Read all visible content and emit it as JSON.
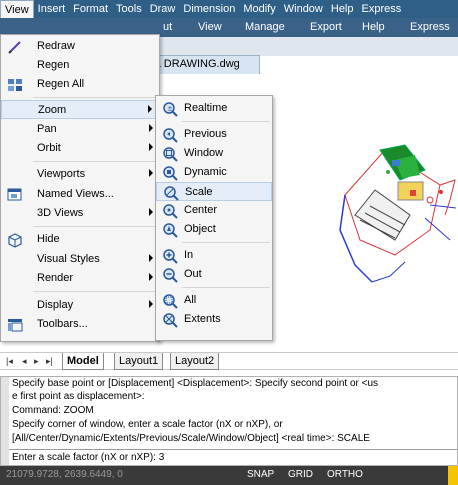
{
  "menubar": {
    "items": [
      "View",
      "Insert",
      "Format",
      "Tools",
      "Draw",
      "Dimension",
      "Modify",
      "Window",
      "Help",
      "Express"
    ]
  },
  "ribbon": {
    "tabs": [
      "ut",
      "View",
      "Manage",
      "Export",
      "Help",
      "Express"
    ]
  },
  "file_tab": {
    "label": "L DRAWING.dwg"
  },
  "view_menu": {
    "items": [
      {
        "label": "Redraw",
        "icon": "pencil-icon"
      },
      {
        "label": "Regen",
        "icon": ""
      },
      {
        "label": "Regen All",
        "icon": "regen-all-icon"
      },
      {
        "label": "Zoom",
        "icon": "",
        "submenu": true
      },
      {
        "label": "Pan",
        "icon": "",
        "submenu": true
      },
      {
        "label": "Orbit",
        "icon": "",
        "submenu": true
      },
      {
        "label": "Viewports",
        "icon": "",
        "submenu": true
      },
      {
        "label": "Named Views...",
        "icon": "named-views-icon"
      },
      {
        "label": "3D Views",
        "icon": "",
        "submenu": true
      },
      {
        "label": "Hide",
        "icon": "hide-cube-icon"
      },
      {
        "label": "Visual Styles",
        "icon": "",
        "submenu": true
      },
      {
        "label": "Render",
        "icon": "",
        "submenu": true
      },
      {
        "label": "Display",
        "icon": "",
        "submenu": true
      },
      {
        "label": "Toolbars...",
        "icon": "toolbars-icon"
      }
    ]
  },
  "zoom_submenu": {
    "items": [
      {
        "label": "Realtime",
        "icon": "zoom-realtime-icon"
      },
      {
        "label": "Previous",
        "icon": "zoom-previous-icon"
      },
      {
        "label": "Window",
        "icon": "zoom-window-icon"
      },
      {
        "label": "Dynamic",
        "icon": "zoom-dynamic-icon"
      },
      {
        "label": "Scale",
        "icon": "zoom-scale-icon"
      },
      {
        "label": "Center",
        "icon": "zoom-center-icon"
      },
      {
        "label": "Object",
        "icon": "zoom-object-icon"
      },
      {
        "label": "In",
        "icon": "zoom-in-icon"
      },
      {
        "label": "Out",
        "icon": "zoom-out-icon"
      },
      {
        "label": "All",
        "icon": "zoom-all-icon"
      },
      {
        "label": "Extents",
        "icon": "zoom-extents-icon"
      }
    ]
  },
  "layout_tabs": {
    "nav": [
      "|◂",
      "◂",
      "▸",
      "▸|"
    ],
    "tabs": [
      "Model",
      "Layout1",
      "Layout2"
    ]
  },
  "command_window": {
    "lines": [
      "Specify base point or [Displacement] <Displacement>: Specify second point or <us",
      "e first point as displacement>:",
      "Command: ZOOM",
      "Specify corner of window, enter a scale factor (nX or nXP), or",
      "[All/Center/Dynamic/Extents/Previous/Scale/Window/Object] <real time>: SCALE"
    ],
    "input": "Enter a scale factor (nX or nXP): 3"
  },
  "status_bar": {
    "coords": "21079.9728, 2639.6449, 0",
    "toggles": [
      "SNAP",
      "GRID",
      "ORTHO"
    ]
  },
  "colors": {
    "menubar_bg": "#2f5f86",
    "menu_bg": "#f5f5f5",
    "highlight": "#e3ecf7",
    "status_bg": "#3a3a3a"
  }
}
